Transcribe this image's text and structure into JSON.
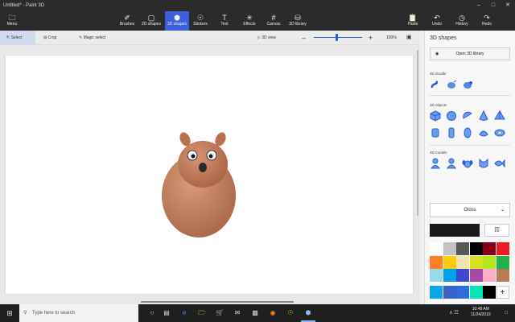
{
  "window": {
    "title": "Untitled* - Paint 3D",
    "minimize_icon": "minimize-icon",
    "maximize_icon": "maximize-icon",
    "close_icon": "close-icon"
  },
  "ribbon": {
    "menu": "Menu",
    "tools": [
      "Brushes",
      "2D shapes",
      "3D shapes",
      "Stickers",
      "Text",
      "Effects",
      "Canvas",
      "3D library"
    ],
    "active_tool": "3D shapes",
    "right": [
      "Paste",
      "Undo",
      "History",
      "Redo"
    ]
  },
  "subbar": {
    "select": "Select",
    "crop": "Crop",
    "magic_select": "Magic select",
    "view3d": "3D view",
    "zoom": "100%",
    "zoom_level": 0.5
  },
  "panel": {
    "title": "3D shapes",
    "open_library": "Open 3D library",
    "doodle_label": "3D doodle",
    "objects_label": "3D objects",
    "models_label": "3D models",
    "material": "Gloss",
    "palette": [
      "#ffffff",
      "#c3c3c3",
      "#585858",
      "#000000",
      "#880015",
      "#ed1c24",
      "#ff7f27",
      "#ffc90e",
      "#efe4b0",
      "#d9e021",
      "#b5e61d",
      "#22b14c",
      "#99d9ea",
      "#00a2e8",
      "#3f48cc",
      "#a349a4",
      "#ffaec9",
      "#b97a57"
    ],
    "palette_extra": [
      "#0ea5e9",
      "#3a63c9",
      "#2d6cdf",
      "#00e5b8",
      "#000000"
    ],
    "selected_color": "#1a1a1a"
  },
  "taskbar": {
    "search_placeholder": "Type here to search",
    "time": "10:48 AM",
    "date": "11/24/2019"
  }
}
